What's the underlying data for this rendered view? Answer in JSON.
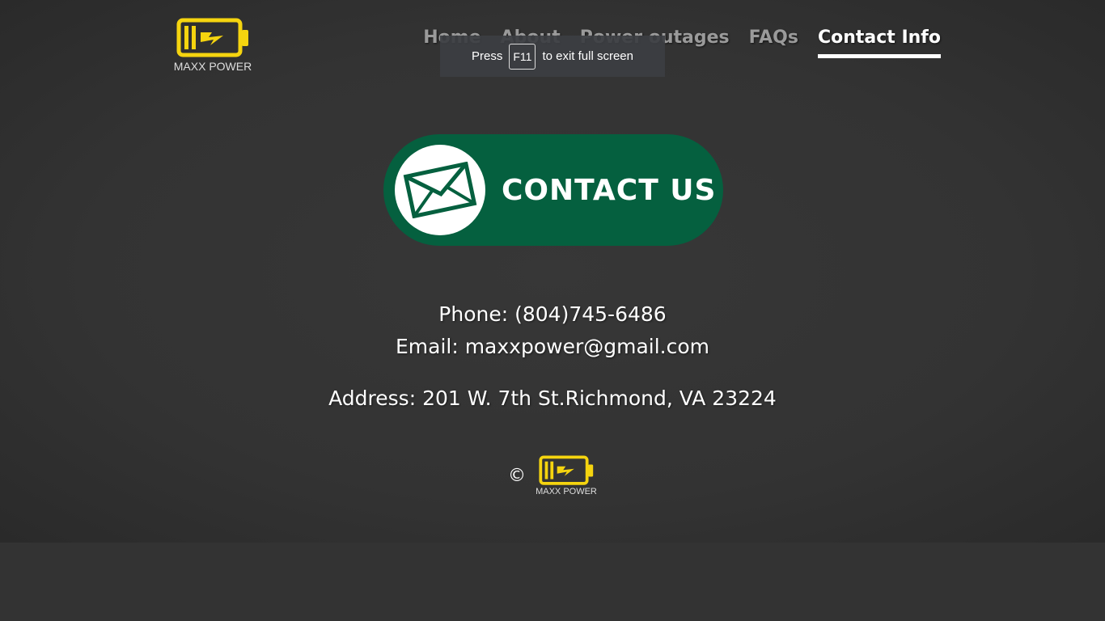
{
  "brand": {
    "name": "MAXX POWER",
    "accent_color": "#f5d40f"
  },
  "nav": {
    "items": [
      {
        "label": "Home",
        "active": false
      },
      {
        "label": "About",
        "active": false
      },
      {
        "label": "Power outages",
        "active": false
      },
      {
        "label": "FAQs",
        "active": false
      },
      {
        "label": "Contact Info",
        "active": true
      }
    ]
  },
  "fullscreen_toast": {
    "prefix": "Press",
    "key": "F11",
    "suffix": "to exit full screen"
  },
  "banner": {
    "text": "CONTACT US",
    "icon": "envelope-icon",
    "color": "#05603f"
  },
  "contact": {
    "phone": "Phone: (804)745-6486",
    "email": "Email: maxxpower@gmail.com",
    "address": "Address: 201 W. 7th St.Richmond, VA 23224"
  },
  "footer": {
    "copyright": "©",
    "logo_text": "MAXX POWER"
  }
}
